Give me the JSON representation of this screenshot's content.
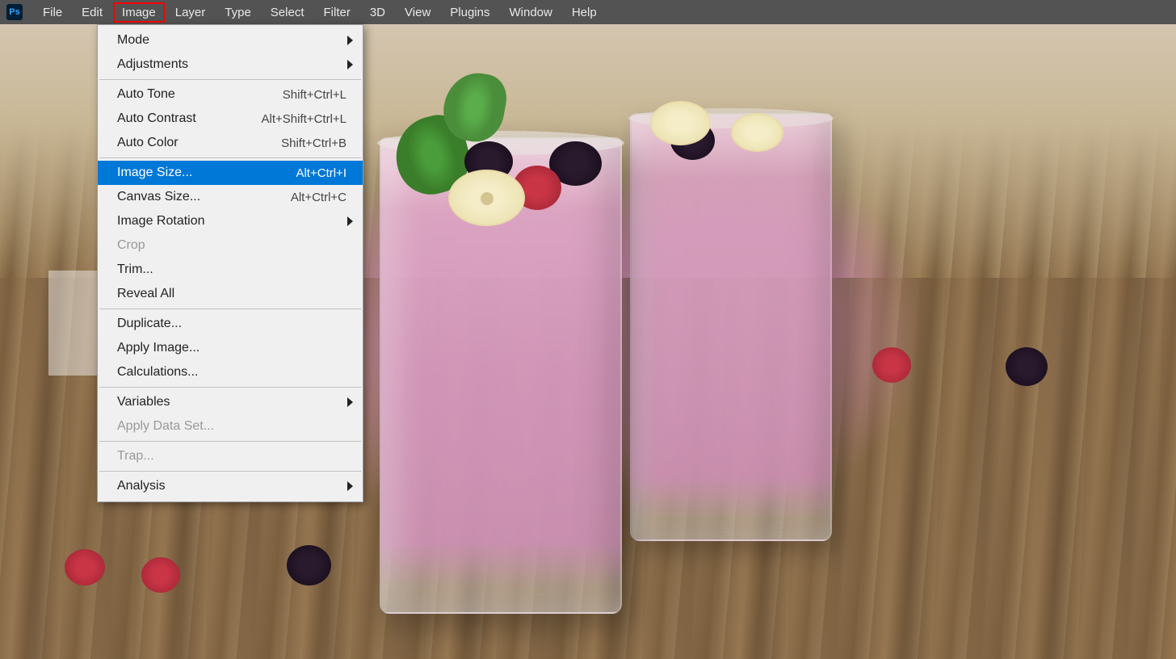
{
  "app": {
    "icon_label": "Ps"
  },
  "menubar": {
    "items": [
      {
        "label": "File"
      },
      {
        "label": "Edit"
      },
      {
        "label": "Image"
      },
      {
        "label": "Layer"
      },
      {
        "label": "Type"
      },
      {
        "label": "Select"
      },
      {
        "label": "Filter"
      },
      {
        "label": "3D"
      },
      {
        "label": "View"
      },
      {
        "label": "Plugins"
      },
      {
        "label": "Window"
      },
      {
        "label": "Help"
      }
    ],
    "active_index": 2
  },
  "dropdown": {
    "groups": [
      [
        {
          "label": "Mode",
          "submenu": true
        },
        {
          "label": "Adjustments",
          "submenu": true
        }
      ],
      [
        {
          "label": "Auto Tone",
          "shortcut": "Shift+Ctrl+L"
        },
        {
          "label": "Auto Contrast",
          "shortcut": "Alt+Shift+Ctrl+L"
        },
        {
          "label": "Auto Color",
          "shortcut": "Shift+Ctrl+B"
        }
      ],
      [
        {
          "label": "Image Size...",
          "shortcut": "Alt+Ctrl+I",
          "highlighted": true
        },
        {
          "label": "Canvas Size...",
          "shortcut": "Alt+Ctrl+C"
        },
        {
          "label": "Image Rotation",
          "submenu": true
        },
        {
          "label": "Crop",
          "disabled": true
        },
        {
          "label": "Trim..."
        },
        {
          "label": "Reveal All"
        }
      ],
      [
        {
          "label": "Duplicate..."
        },
        {
          "label": "Apply Image..."
        },
        {
          "label": "Calculations..."
        }
      ],
      [
        {
          "label": "Variables",
          "submenu": true
        },
        {
          "label": "Apply Data Set...",
          "disabled": true
        }
      ],
      [
        {
          "label": "Trap...",
          "disabled": true
        }
      ],
      [
        {
          "label": "Analysis",
          "submenu": true
        }
      ]
    ]
  }
}
